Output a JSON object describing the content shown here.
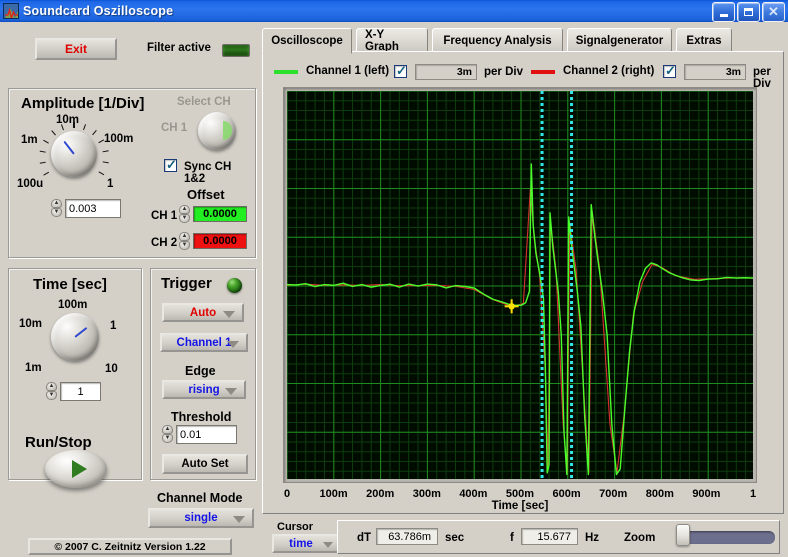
{
  "window": {
    "title": "Soundcard Oszilloscope",
    "icon": "waveform-app-icon",
    "minimize": "–",
    "maximize": "□",
    "close": "✕"
  },
  "toolbar": {
    "exit_label": "Exit",
    "filter_label": "Filter active",
    "filter_led_state": "off"
  },
  "tabs": [
    {
      "label": "Oscilloscope",
      "active": true
    },
    {
      "label": "X-Y Graph",
      "active": false
    },
    {
      "label": "Frequency Analysis",
      "active": false
    },
    {
      "label": "Signalgenerator",
      "active": false
    },
    {
      "label": "Extras",
      "active": false
    }
  ],
  "channels": [
    {
      "name": "Channel 1 (left)",
      "color": "#2ee02e",
      "enabled": true,
      "per_div_value": "3m",
      "per_div_unit": "per Div"
    },
    {
      "name": "Channel 2 (right)",
      "color": "#e01010",
      "enabled": true,
      "per_div_value": "3m",
      "per_div_unit": "per Div"
    }
  ],
  "amplitude": {
    "title": "Amplitude [1/Div]",
    "knob_labels": [
      "1m",
      "10m",
      "100m",
      "1",
      "100u"
    ],
    "value": "0.003",
    "select_ch_label": "Select CH",
    "select_ch_value": "CH 1",
    "sync_label": "Sync CH 1&2",
    "sync_checked": true,
    "offset_title": "Offset",
    "offsets": [
      {
        "label": "CH 1",
        "value": "0.0000",
        "color": "#22ee22"
      },
      {
        "label": "CH 2",
        "value": "0.0000",
        "color": "#ee1111"
      }
    ]
  },
  "time": {
    "title": "Time [sec]",
    "knob_labels": [
      "10m",
      "100m",
      "1",
      "10",
      "1m"
    ],
    "value": "1"
  },
  "trigger": {
    "title": "Trigger",
    "led_state": "on",
    "mode": "Auto",
    "mode_color": "#e00000",
    "source": "Channel 1",
    "source_color": "#1414e6",
    "edge_label": "Edge",
    "edge": "rising",
    "edge_color": "#1414e6",
    "threshold_label": "Threshold",
    "threshold": "0.01",
    "autoset_label": "Auto Set"
  },
  "run": {
    "label": "Run/Stop",
    "state": "running"
  },
  "channel_mode": {
    "label": "Channel Mode",
    "value": "single",
    "value_color": "#1414e6"
  },
  "copyright": "© 2007   C. Zeitnitz Version 1.22",
  "cursor": {
    "label": "Cursor",
    "mode": "time",
    "mode_color": "#1414e6",
    "dt_label": "dT",
    "dt_value": "63.786m",
    "dt_unit": "sec",
    "f_label": "f",
    "f_value": "15.677",
    "f_unit": "Hz",
    "zoom_label": "Zoom",
    "zoom_position": 0
  },
  "chart_data": {
    "type": "line",
    "title": "",
    "xlabel": "Time [sec]",
    "ylabel": "",
    "xlim": [
      0,
      1
    ],
    "ylim": [
      -0.024,
      0.024
    ],
    "grid": true,
    "major_divs_x": 10,
    "major_divs_y": 8,
    "minor_per_major": 5,
    "background": "#010c01",
    "grid_color_major": "#1f8a1f",
    "grid_color_minor": "#0d3d0d",
    "xticks": [
      "0",
      "100m",
      "200m",
      "300m",
      "400m",
      "500m",
      "600m",
      "700m",
      "800m",
      "900m",
      "1"
    ],
    "cursors": {
      "color": "#30e8e8",
      "x_values": [
        0.545,
        0.608
      ]
    },
    "marker": {
      "color": "#ffe000",
      "x": 0.48,
      "y": -0.0025
    },
    "series": [
      {
        "name": "Channel 1 (left)",
        "color": "#4aff2a",
        "points": [
          [
            0.0,
            0.0002
          ],
          [
            0.02,
            0.0001
          ],
          [
            0.04,
            0.0003
          ],
          [
            0.06,
            0.0
          ],
          [
            0.08,
            0.0002
          ],
          [
            0.1,
            0.0001
          ],
          [
            0.12,
            0.0003
          ],
          [
            0.14,
            0.0
          ],
          [
            0.16,
            0.0002
          ],
          [
            0.18,
            -0.0001
          ],
          [
            0.2,
            0.0001
          ],
          [
            0.22,
            0.0002
          ],
          [
            0.24,
            -0.0001
          ],
          [
            0.26,
            0.0002
          ],
          [
            0.28,
            0.0
          ],
          [
            0.3,
            0.0002
          ],
          [
            0.32,
            0.0001
          ],
          [
            0.34,
            -0.0002
          ],
          [
            0.36,
            0.0001
          ],
          [
            0.38,
            0.0
          ],
          [
            0.4,
            -0.0003
          ],
          [
            0.42,
            -0.001
          ],
          [
            0.44,
            -0.0016
          ],
          [
            0.46,
            -0.002
          ],
          [
            0.48,
            -0.0024
          ],
          [
            0.5,
            -0.0024
          ],
          [
            0.51,
            -0.002
          ],
          [
            0.518,
            -0.0006
          ],
          [
            0.522,
            0.015
          ],
          [
            0.526,
            0.0075
          ],
          [
            0.532,
            0.004
          ],
          [
            0.54,
            0.0015
          ],
          [
            0.548,
            -0.0015
          ],
          [
            0.552,
            -0.01
          ],
          [
            0.556,
            -0.023
          ],
          [
            0.56,
            -0.022
          ],
          [
            0.562,
            0.009
          ],
          [
            0.568,
            0.0048
          ],
          [
            0.574,
            0.002
          ],
          [
            0.58,
            -0.001
          ],
          [
            0.586,
            -0.006
          ],
          [
            0.592,
            -0.018
          ],
          [
            0.598,
            -0.0232
          ],
          [
            0.602,
            0.0085
          ],
          [
            0.608,
            0.005
          ],
          [
            0.614,
            0.0022
          ],
          [
            0.62,
            -0.0005
          ],
          [
            0.628,
            -0.005
          ],
          [
            0.636,
            -0.016
          ],
          [
            0.644,
            -0.0232
          ],
          [
            0.65,
            0.01
          ],
          [
            0.658,
            0.006
          ],
          [
            0.666,
            0.0025
          ],
          [
            0.674,
            -0.0008
          ],
          [
            0.684,
            -0.006
          ],
          [
            0.694,
            -0.017
          ],
          [
            0.704,
            -0.0232
          ],
          [
            0.712,
            -0.0225
          ],
          [
            0.722,
            -0.015
          ],
          [
            0.732,
            -0.008
          ],
          [
            0.742,
            -0.003
          ],
          [
            0.754,
            0.0005
          ],
          [
            0.766,
            0.0022
          ],
          [
            0.778,
            0.0028
          ],
          [
            0.79,
            0.0026
          ],
          [
            0.802,
            0.0022
          ],
          [
            0.816,
            0.0017
          ],
          [
            0.83,
            0.0013
          ],
          [
            0.846,
            0.001
          ],
          [
            0.862,
            0.0008
          ],
          [
            0.88,
            0.0007
          ],
          [
            0.9,
            0.0008
          ],
          [
            0.92,
            0.0009
          ],
          [
            0.94,
            0.001
          ],
          [
            0.96,
            0.001
          ],
          [
            0.98,
            0.001
          ],
          [
            1.0,
            0.001
          ]
        ]
      },
      {
        "name": "Channel 2 (right)",
        "color": "#d83030",
        "points": [
          [
            0.0,
            0.0001
          ],
          [
            0.04,
            0.0002
          ],
          [
            0.08,
            0.0001
          ],
          [
            0.12,
            0.0002
          ],
          [
            0.16,
            0.0001
          ],
          [
            0.2,
            0.0002
          ],
          [
            0.24,
            0.0
          ],
          [
            0.28,
            0.0001
          ],
          [
            0.32,
            0.0001
          ],
          [
            0.36,
            0.0
          ],
          [
            0.4,
            -0.0004
          ],
          [
            0.44,
            -0.0017
          ],
          [
            0.48,
            -0.0025
          ],
          [
            0.505,
            -0.0022
          ],
          [
            0.52,
            0.012
          ],
          [
            0.528,
            0.006
          ],
          [
            0.54,
            0.0012
          ],
          [
            0.552,
            -0.0105
          ],
          [
            0.558,
            -0.0225
          ],
          [
            0.563,
            0.008
          ],
          [
            0.575,
            0.0018
          ],
          [
            0.59,
            -0.017
          ],
          [
            0.599,
            -0.023
          ],
          [
            0.604,
            0.0078
          ],
          [
            0.618,
            0.0018
          ],
          [
            0.638,
            -0.0165
          ],
          [
            0.645,
            -0.023
          ],
          [
            0.652,
            0.0092
          ],
          [
            0.668,
            0.0022
          ],
          [
            0.69,
            -0.017
          ],
          [
            0.705,
            -0.023
          ],
          [
            0.72,
            -0.016
          ],
          [
            0.74,
            -0.0035
          ],
          [
            0.76,
            0.0006
          ],
          [
            0.78,
            0.0026
          ],
          [
            0.8,
            0.0023
          ],
          [
            0.83,
            0.0013
          ],
          [
            0.87,
            0.0008
          ],
          [
            0.92,
            0.0009
          ],
          [
            0.97,
            0.001
          ],
          [
            1.0,
            0.001
          ]
        ]
      }
    ]
  }
}
